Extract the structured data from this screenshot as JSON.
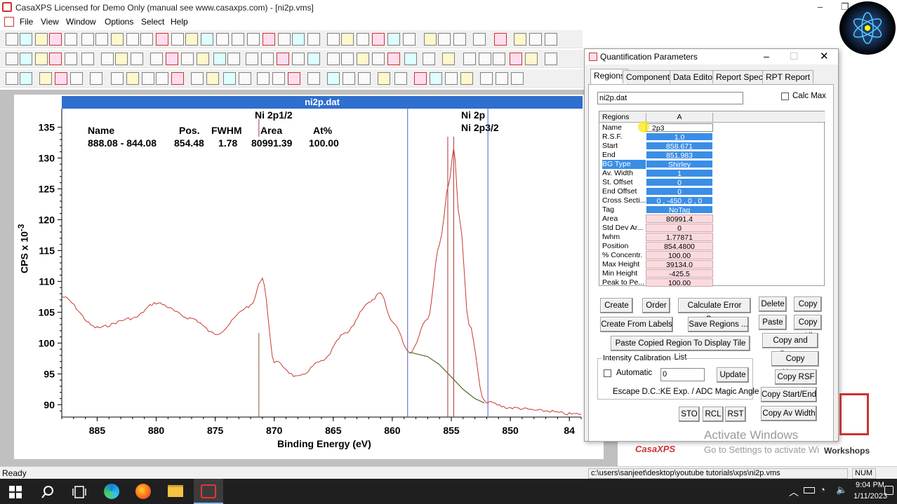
{
  "app": {
    "title": "CasaXPS Licensed for Demo Only (manual see www.casaxps.com) - [ni2p.vms]",
    "menu": [
      "File",
      "View",
      "Window",
      "Options",
      "Select",
      "Help"
    ]
  },
  "document": {
    "title": "ni2p.dat",
    "table_header": {
      "name": "Name",
      "pos": "Pos.",
      "fwhm": "FWHM",
      "area": "Area",
      "at": "At%"
    },
    "table_row": {
      "name": "888.08 - 844.08",
      "pos": "854.48",
      "fwhm": "1.78",
      "area": "80991.39",
      "at": "100.00"
    },
    "peak_labels": {
      "p1": "Ni 2p1/2",
      "p2": "Ni 2p",
      "p3": "Ni 2p3/2"
    }
  },
  "chart_data": {
    "type": "line",
    "xlabel": "Binding Energy (eV)",
    "ylabel": "CPS x 10-3",
    "x_ticks": [
      "885",
      "880",
      "875",
      "870",
      "865",
      "860",
      "855",
      "850",
      "84"
    ],
    "y_ticks": [
      "135",
      "130",
      "125",
      "120",
      "115",
      "110",
      "105",
      "100",
      "95",
      "90"
    ],
    "xlim": [
      888,
      844
    ],
    "ylim": [
      88,
      138
    ],
    "x": [
      888,
      885,
      882,
      880,
      877,
      875,
      872,
      871,
      870,
      868,
      866,
      864,
      862,
      861,
      860,
      858.5,
      857,
      856,
      855.2,
      854.8,
      854.3,
      853.5,
      852.2,
      850,
      847,
      845,
      844
    ],
    "y": [
      107.5,
      102.5,
      104,
      106.5,
      104,
      101.5,
      106,
      110.5,
      97,
      94.5,
      97,
      101.5,
      106.5,
      108,
      103.5,
      98.5,
      104,
      116,
      126,
      131.5,
      120,
      103,
      90.5,
      89.5,
      89,
      88.5,
      88.5
    ],
    "background_x": [
      858.5,
      857,
      856,
      855,
      854,
      853,
      852.2
    ],
    "background_y": [
      98.5,
      97.8,
      96.5,
      94.5,
      92.5,
      91,
      90.3
    ],
    "markers": [
      {
        "x": 871.3,
        "label": "Ni 2p1/2"
      },
      {
        "x": 855.3,
        "label": "Ni 2p"
      },
      {
        "x": 854.8,
        "label": "Ni 2p3/2"
      }
    ],
    "region_lines": [
      858.7,
      851.9
    ]
  },
  "dialog": {
    "title": "Quantification Parameters",
    "tabs": [
      "Regions",
      "Components",
      "Data Editor",
      "Report Spec.",
      "RPT Report"
    ],
    "file": "ni2p.dat",
    "calc_max": "Calc Max",
    "grid_header": {
      "col0": "Regions",
      "col1": "A"
    },
    "rows": [
      {
        "k": "Name",
        "v": "2p3",
        "s": "name"
      },
      {
        "k": "R.S.F.",
        "v": "1.0",
        "s": "blue"
      },
      {
        "k": "Start",
        "v": "858.671",
        "s": "blue"
      },
      {
        "k": "End",
        "v": "851.983",
        "s": "blue"
      },
      {
        "k": "BG Type",
        "v": "Shirley",
        "s": "blue"
      },
      {
        "k": "Av. Width",
        "v": "1",
        "s": "blue"
      },
      {
        "k": "St. Offset",
        "v": "0",
        "s": "blue"
      },
      {
        "k": "End Offset",
        "v": "0",
        "s": "blue"
      },
      {
        "k": "Cross Secti...",
        "v": "0 , -450 , 0 , 0",
        "s": "blue"
      },
      {
        "k": "Tag",
        "v": "NoTag",
        "s": "blue"
      },
      {
        "k": "Area",
        "v": "80991.4",
        "s": "pink"
      },
      {
        "k": "Std Dev Ar...",
        "v": "0",
        "s": "pink"
      },
      {
        "k": "fwhm",
        "v": "1.77871",
        "s": "pink"
      },
      {
        "k": "Position",
        "v": "854.4800",
        "s": "pink"
      },
      {
        "k": "% Concentr.",
        "v": "100.00",
        "s": "pink"
      },
      {
        "k": "Max Height",
        "v": "39134.0",
        "s": "pink"
      },
      {
        "k": "Min Height",
        "v": "-425.5",
        "s": "pink"
      },
      {
        "k": "Peak to Pe...",
        "v": "100.00",
        "s": "pink"
      }
    ],
    "buttons": {
      "create": "Create",
      "order": "Order",
      "calc_err": "Calculate Error Bars",
      "delete": "Delete",
      "copy": "Copy",
      "create_labels": "Create From Labels",
      "save_regions": "Save Regions ...",
      "paste": "Paste",
      "copy_all": "Copy All",
      "paste_tile": "Paste Copied Region To Display Tile List",
      "copy_paste": "Copy and Paste",
      "copy_names": "Copy Names",
      "copy_rsf": "Copy RSF",
      "copy_start_end": "Copy Start/End",
      "copy_av_width": "Copy Av Width",
      "update": "Update",
      "sto": "STO",
      "rcl": "RCL",
      "rst": "RST"
    },
    "intensity": {
      "group": "Intensity Calibration",
      "automatic": "Automatic",
      "value": "0",
      "escape": "Escape D.C.:KE Exp. / ADC Magic Angle"
    }
  },
  "watermark": {
    "line1": "Activate Windows",
    "line2": "Go to Settings to activate Wi",
    "workshops": "Workshops",
    "logo": "CasaXPS"
  },
  "status": {
    "left": "Ready",
    "path": "c:\\users\\sanjeet\\desktop\\youtube tutorials\\xps\\ni2p.vms",
    "num": "NUM"
  },
  "taskbar": {
    "time": "9:04 PM",
    "date": "1/11/2023"
  }
}
